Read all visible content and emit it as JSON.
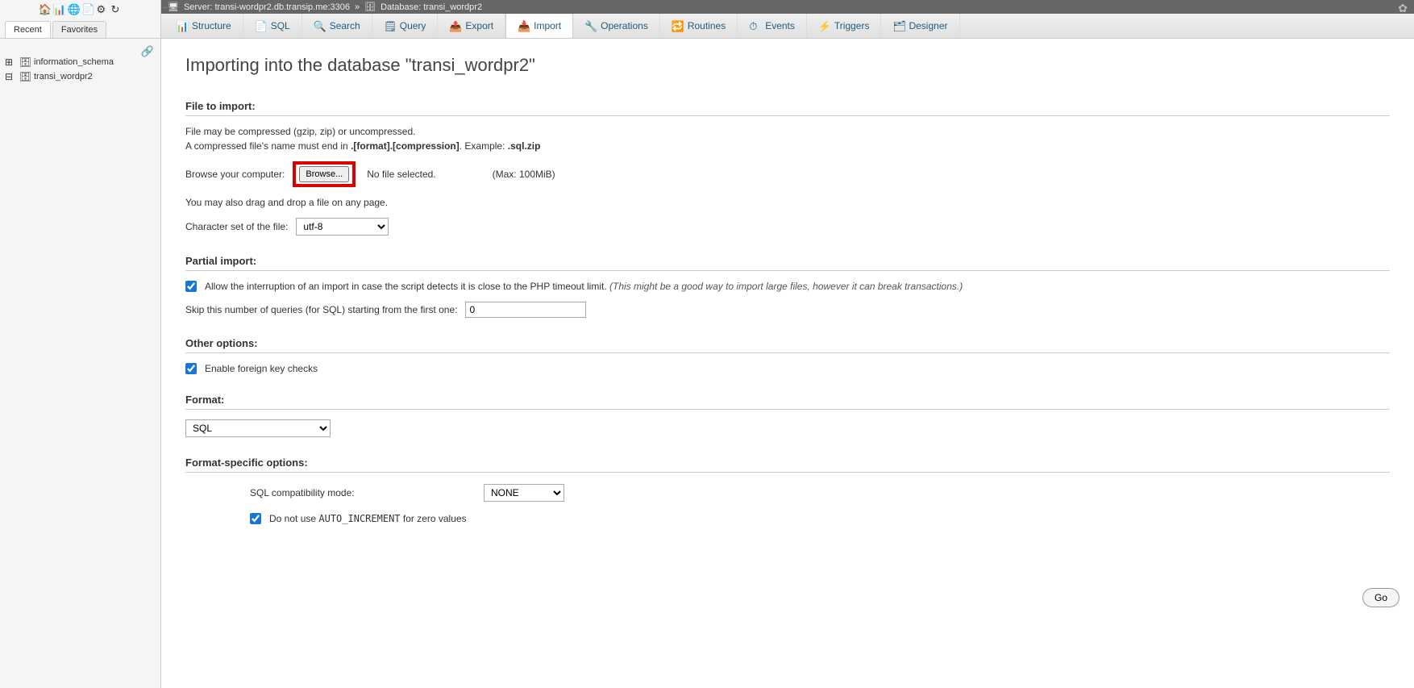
{
  "sidebar": {
    "icons": [
      "🏠",
      "📊",
      "🌐",
      "📄",
      "⚙",
      "↻"
    ],
    "tabs": [
      "Recent",
      "Favorites"
    ],
    "dbs": [
      "information_schema",
      "transi_wordpr2"
    ]
  },
  "topbar": {
    "server_label": "Server: transi-wordpr2.db.transip.me:3306",
    "db_label": "Database: transi_wordpr2"
  },
  "tabs": [
    {
      "icon": "📊",
      "label": "Structure"
    },
    {
      "icon": "📄",
      "label": "SQL"
    },
    {
      "icon": "🔍",
      "label": "Search"
    },
    {
      "icon": "🗒",
      "label": "Query"
    },
    {
      "icon": "📤",
      "label": "Export"
    },
    {
      "icon": "📥",
      "label": "Import",
      "active": true
    },
    {
      "icon": "🔧",
      "label": "Operations"
    },
    {
      "icon": "🔁",
      "label": "Routines"
    },
    {
      "icon": "⏱",
      "label": "Events"
    },
    {
      "icon": "⚡",
      "label": "Triggers"
    },
    {
      "icon": "🗂",
      "label": "Designer"
    }
  ],
  "page": {
    "title": "Importing into the database \"transi_wordpr2\"",
    "file_to_import": "File to import:",
    "file_hint1": "File may be compressed (gzip, zip) or uncompressed.",
    "file_hint2a": "A compressed file's name must end in ",
    "file_hint2b": ".[format].[compression]",
    "file_hint2c": ". Example: ",
    "file_hint2d": ".sql.zip",
    "browse_label": "Browse your computer:",
    "browse_btn": "Browse...",
    "no_file": "No file selected.",
    "max_size": "(Max: 100MiB)",
    "dragdrop": "You may also drag and drop a file on any page.",
    "charset_label": "Character set of the file:",
    "charset_value": "utf-8",
    "partial_import": "Partial import:",
    "interrupt1": "Allow the interruption of an import in case the script detects it is close to the PHP timeout limit. ",
    "interrupt2": "(This might be a good way to import large files, however it can break transactions.)",
    "skip_label": "Skip this number of queries (for SQL) starting from the first one:",
    "skip_value": "0",
    "other_options": "Other options:",
    "fk_label": "Enable foreign key checks",
    "format": "Format:",
    "format_value": "SQL",
    "format_specific": "Format-specific options:",
    "sql_compat_label": "SQL compatibility mode:",
    "sql_compat_value": "NONE",
    "no_auto1": "Do not use ",
    "no_auto2": "AUTO_INCREMENT",
    "no_auto3": " for zero values",
    "go": "Go"
  }
}
